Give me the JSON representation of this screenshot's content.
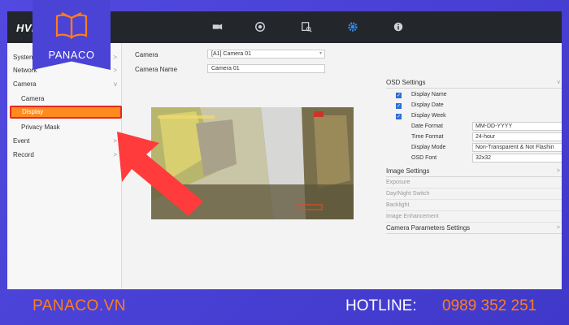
{
  "brand": {
    "top_text": "HVR",
    "logo_text": "PANACO",
    "website": "PANACO.VN",
    "hotline_label": "HOTLINE:",
    "hotline_number": "0989 352 251",
    "accent": "#ff7d1c",
    "bg": "#4a43d6"
  },
  "topbar": {
    "icons": [
      "camera-icon",
      "playback-icon",
      "search-icon",
      "settings-icon",
      "info-icon"
    ],
    "active": "settings-icon"
  },
  "sidebar": {
    "items": [
      {
        "label": "System",
        "chevron": ">"
      },
      {
        "label": "Network",
        "chevron": ">"
      },
      {
        "label": "Camera",
        "chevron": "v"
      },
      {
        "label": "Camera"
      },
      {
        "label": "Display"
      },
      {
        "label": "Privacy Mask"
      },
      {
        "label": "Event",
        "chevron": ">"
      },
      {
        "label": "Record",
        "chevron": ">"
      }
    ]
  },
  "main": {
    "camera_label": "Camera",
    "camera_value": "[A1] Camera 01",
    "camera_name_label": "Camera Name",
    "camera_name_value": "Camera 01"
  },
  "osd": {
    "title": "OSD Settings",
    "checks": [
      {
        "label": "Display Name",
        "checked": true
      },
      {
        "label": "Display Date",
        "checked": true
      },
      {
        "label": "Display Week",
        "checked": true
      }
    ],
    "rows": [
      {
        "label": "Date Format",
        "value": "MM-DD-YYYY"
      },
      {
        "label": "Time Format",
        "value": "24-hour"
      },
      {
        "label": "Display Mode",
        "value": "Non-Transparent & Not Flashin"
      },
      {
        "label": "OSD Font",
        "value": "32x32"
      }
    ],
    "image_settings": "Image Settings",
    "image_items": [
      "Exposure",
      "Day/Night Switch",
      "Backlight",
      "Image Enhancement"
    ],
    "camera_params": "Camera Parameters Settings"
  }
}
